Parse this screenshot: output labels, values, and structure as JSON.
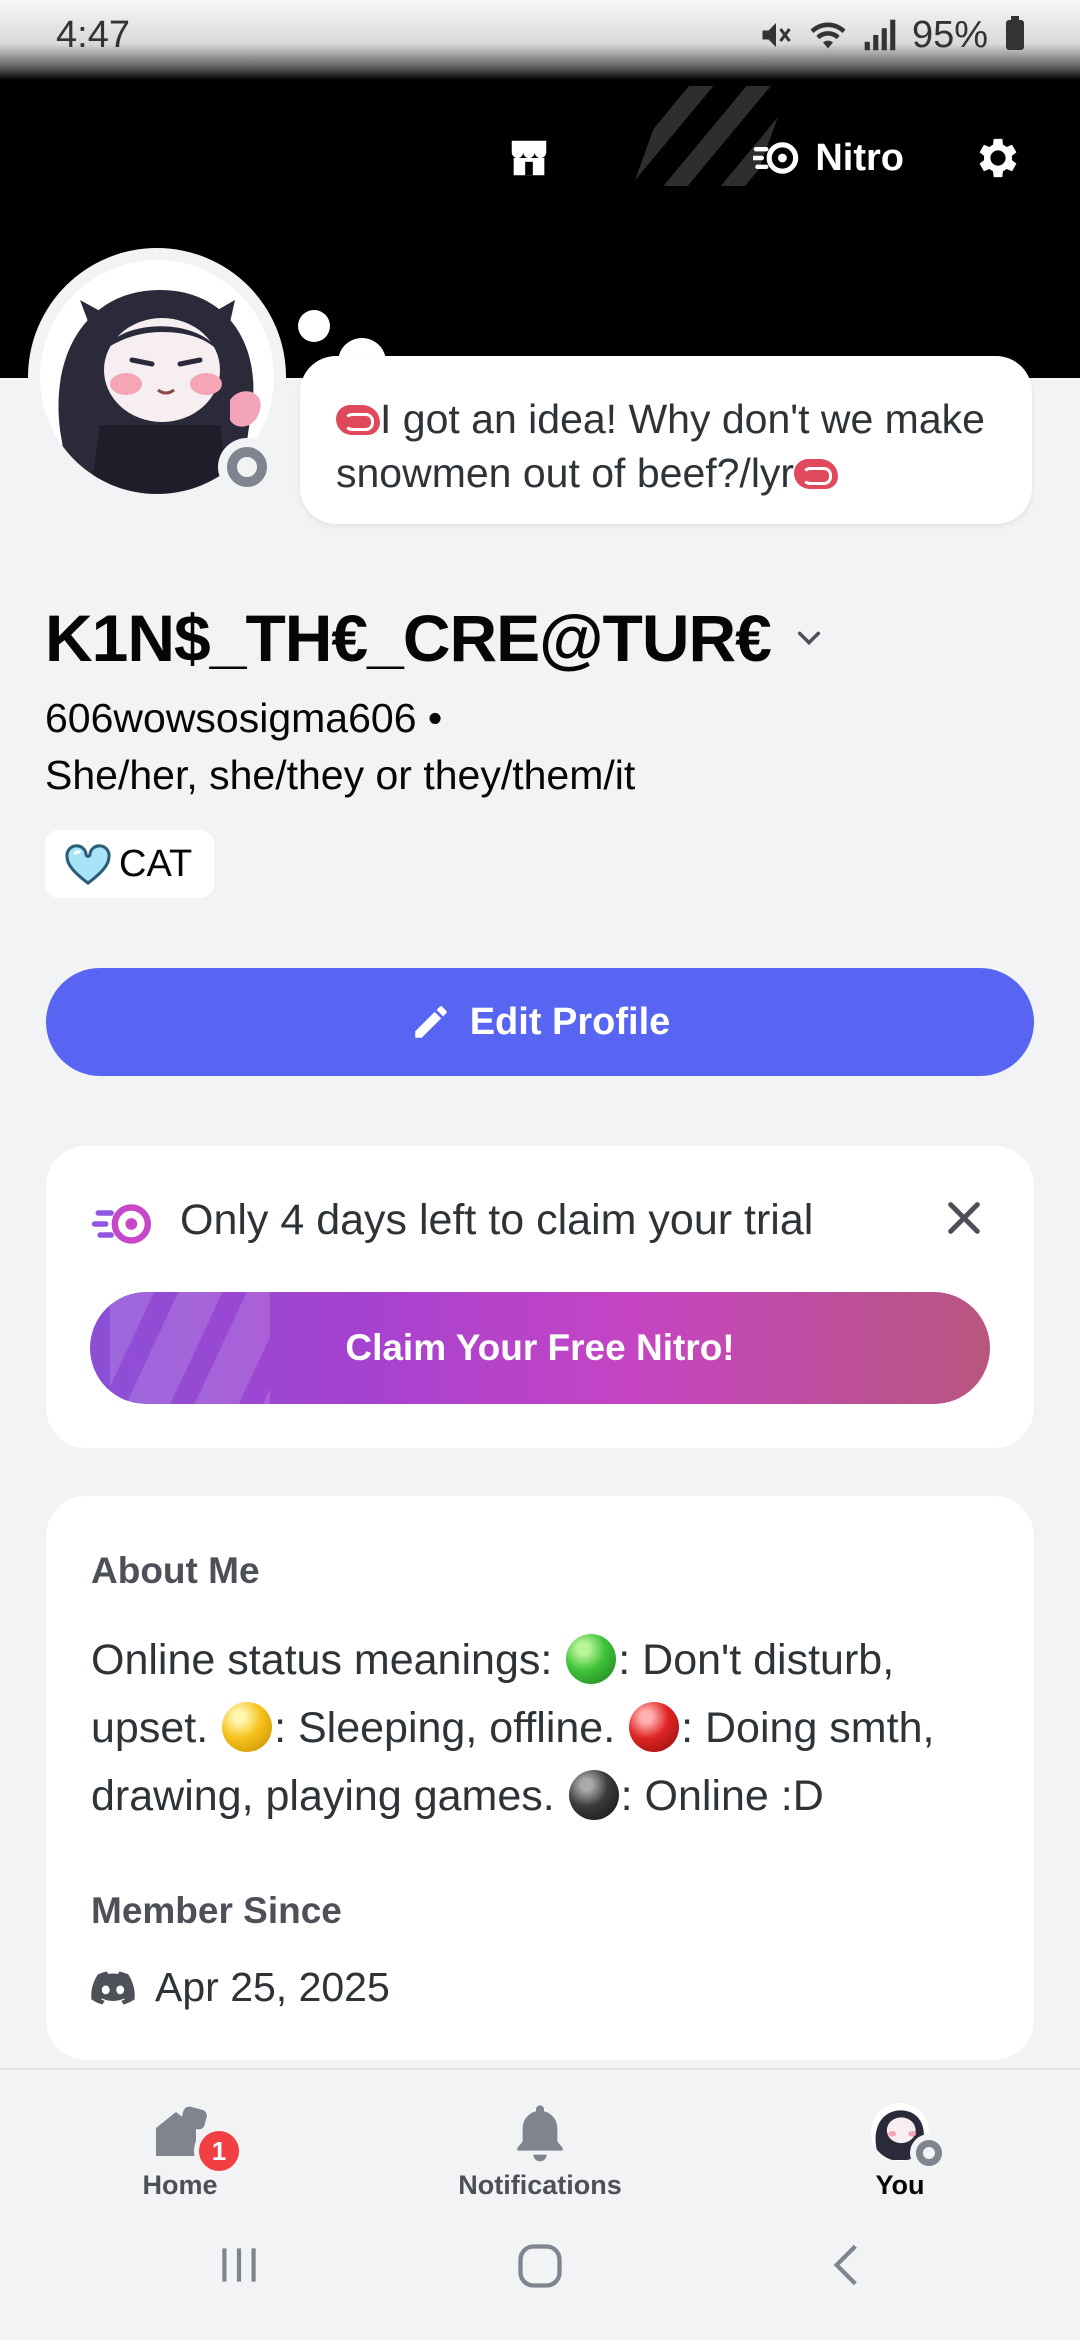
{
  "status_bar": {
    "time": "4:47",
    "battery": "95%"
  },
  "header": {
    "nitro_label": "Nitro"
  },
  "profile": {
    "custom_status": "I got an idea! Why don't we make snowmen out of beef?/lyr",
    "display_name": "K1N$_TH€_CRE@TUR€",
    "username": "606wowsosigma606 •",
    "pronouns": "She/her, she/they or they/them/it",
    "tag": "CAT",
    "edit_profile_label": "Edit Profile"
  },
  "trial_card": {
    "text": "Only 4 days left to claim your trial",
    "claim_label": "Claim Your Free Nitro!"
  },
  "about": {
    "heading": "About Me",
    "part1": "Online status meanings: ",
    "part2": ": Don't disturb, upset. ",
    "part3": ": Sleeping, offline. ",
    "part4": ": Doing smth, drawing, playing games. ",
    "part5": ": Online :D",
    "member_since_heading": "Member Since",
    "member_since_date": "Apr 25, 2025"
  },
  "bottom_nav": {
    "home_label": "Home",
    "home_badge": "1",
    "notifications_label": "Notifications",
    "you_label": "You"
  },
  "colors": {
    "brand": "#5865f2",
    "background": "#f2f3f5",
    "banner": "#000000",
    "status_offline": "#80848e",
    "badge_red": "#f23f43"
  }
}
